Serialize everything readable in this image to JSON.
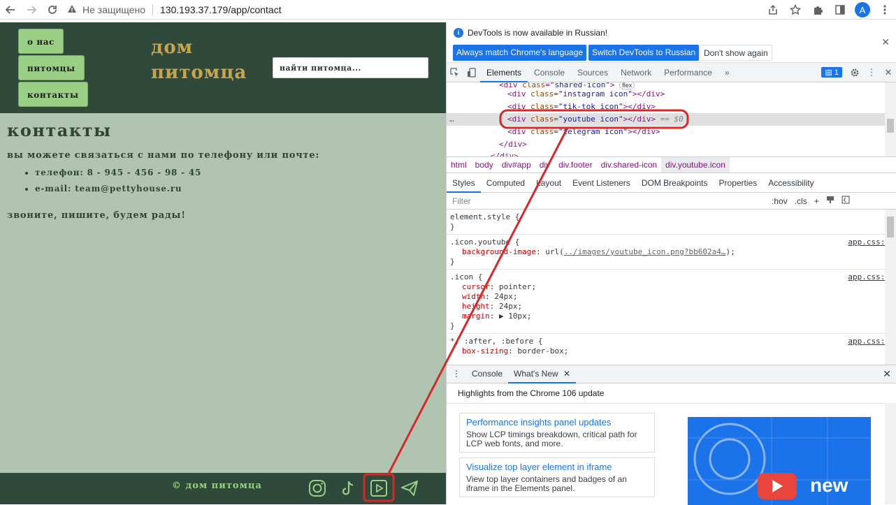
{
  "browser": {
    "security_label": "Не защищено",
    "url": "130.193.37.179/app/contact",
    "avatar_letter": "A"
  },
  "site": {
    "nav": [
      {
        "label": "о нас"
      },
      {
        "label": "питомцы"
      },
      {
        "label": "контакты"
      }
    ],
    "brand_line1": "дом",
    "brand_line2": "питомца",
    "search_placeholder": "найти питомца...",
    "heading": "контакты",
    "intro": "вы можете связаться с нами по телефону или почте:",
    "contacts": [
      "телефон: 8 - 945 - 456 - 98 - 45",
      "e-mail: team@pettyhouse.ru"
    ],
    "closing": "звоните, пишите, будем рады!",
    "footer_copyright": "© дом питомца",
    "social_icons": [
      "instagram-icon",
      "tiktok-icon",
      "youtube-icon",
      "telegram-icon"
    ],
    "colors": {
      "header_bg": "#2f4a3a",
      "body_bg": "#b1c4b1",
      "nav_btn": "#9bcf86",
      "brand": "#c9a44f"
    }
  },
  "devtools": {
    "info_message": "DevTools is now available in Russian!",
    "info_btn_match": "Always match Chrome's language",
    "info_btn_switch": "Switch DevTools to Russian",
    "info_btn_dismiss": "Don't show again",
    "tabs": [
      "Elements",
      "Console",
      "Sources",
      "Network",
      "Performance"
    ],
    "more_tabs": "»",
    "issues_count": "1",
    "dom": {
      "line0_tag": "<div ",
      "line0_attr": "class",
      "line0_val": "\"shared-icon\"",
      "line0_end": ">",
      "flex_badge": "flex",
      "line1_val": "\"instagram icon\"",
      "line2_val": "\"tik-tok icon\"",
      "line3_val": "\"youtube icon\"",
      "line3_suffix": "== $0",
      "line4_val": "\"telegram icon\"",
      "close_div": "</div>",
      "line_ellipsis": "…"
    },
    "breadcrumbs": [
      "html",
      "body",
      "div#app",
      "div",
      "div.footer",
      "div.shared-icon",
      "div.youtube.icon"
    ],
    "subtabs": [
      "Styles",
      "Computed",
      "Layout",
      "Event Listeners",
      "DOM Breakpoints",
      "Properties",
      "Accessibility"
    ],
    "filter_placeholder": "Filter",
    "filter_hov": ":hov",
    "filter_cls": ".cls",
    "styles": {
      "element_style": "element.style {",
      "close_brace": "}",
      "rule1_selector": ".icon.youtube {",
      "rule1_prop": "background-image",
      "rule1_val_prefix": "url(",
      "rule1_link": "../images/youtube_icon.png?bb602a4…",
      "rule1_val_suffix": ");",
      "rule2_selector": ".icon {",
      "rule2_props": [
        {
          "name": "cursor",
          "value": "pointer;"
        },
        {
          "name": "width",
          "value": "24px;"
        },
        {
          "name": "height",
          "value": "24px;"
        },
        {
          "name": "margin",
          "value": "▶ 10px;"
        }
      ],
      "rule3_selector": "*, :after, :before {",
      "rule3_prop": "box-sizing",
      "rule3_val": "border-box;",
      "source": "app.css:6"
    },
    "drawer_tabs": [
      "Console",
      "What's New"
    ],
    "highlights": "Highlights from the Chrome 106 update",
    "whats_new_cards": [
      {
        "title": "Performance insights panel updates",
        "desc": "Show LCP timings breakdown, critical path for LCP web fonts, and more."
      },
      {
        "title": "Visualize top layer element in iframe",
        "desc": "View top layer containers and badges of an iframe in the Elements panel."
      }
    ],
    "promo_text": "new"
  }
}
